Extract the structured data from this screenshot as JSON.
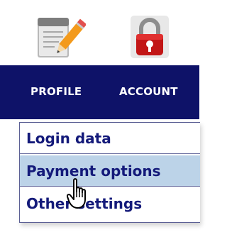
{
  "icons": {
    "profile": "pencil-notepad-icon",
    "account": "red-padlock-icon"
  },
  "nav": {
    "tabs": [
      {
        "label": "PROFILE"
      },
      {
        "label": "ACCOUNT"
      }
    ],
    "background": "#0e1268"
  },
  "dropdown": {
    "items": [
      {
        "label": "Login data"
      },
      {
        "label": "Payment options",
        "state": "hovered"
      },
      {
        "label": "Other settings"
      }
    ],
    "hover_color": "#bcd3e8",
    "text_color": "#141a7a"
  },
  "cursor": "hand-pointer-cursor"
}
